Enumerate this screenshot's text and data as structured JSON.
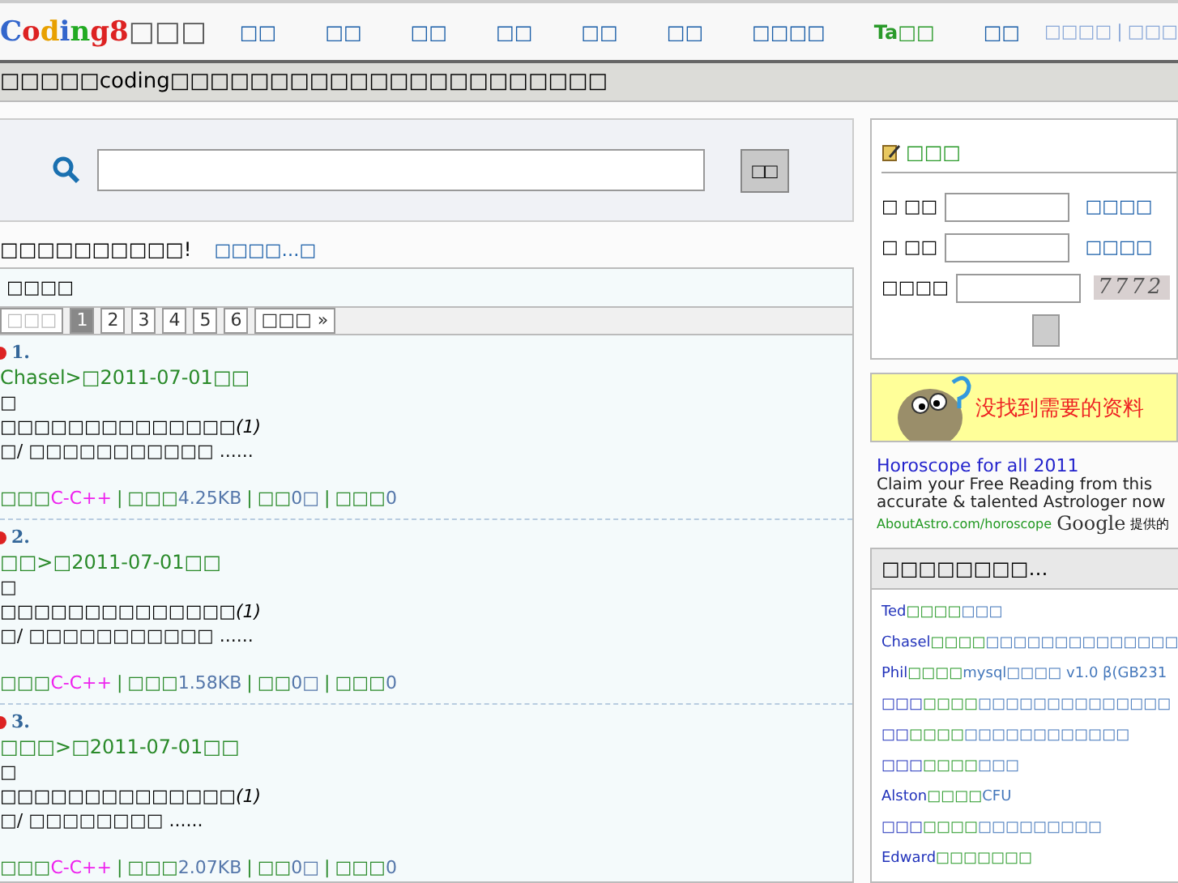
{
  "header": {
    "logo_letters": [
      {
        "ch": "C",
        "color": "#3366cc"
      },
      {
        "ch": "o",
        "color": "#dd2222"
      },
      {
        "ch": "d",
        "color": "#e8a000"
      },
      {
        "ch": "i",
        "color": "#3366cc"
      },
      {
        "ch": "n",
        "color": "#22aa22"
      },
      {
        "ch": "g",
        "color": "#dd2222"
      },
      {
        "ch": "8",
        "color": "#dd2222"
      }
    ],
    "logo_suffix": "□□□",
    "nav": [
      {
        "label": "□□",
        "kind": "normal"
      },
      {
        "label": "□□",
        "kind": "normal"
      },
      {
        "label": "□□",
        "kind": "normal"
      },
      {
        "label": "□□",
        "kind": "normal"
      },
      {
        "label": "□□",
        "kind": "normal"
      },
      {
        "label": "□□",
        "kind": "normal"
      },
      {
        "label": "□□□□",
        "kind": "normal"
      },
      {
        "label": "Ta□□",
        "kind": "highlight"
      },
      {
        "label": "□□",
        "kind": "normal"
      }
    ],
    "account_links": [
      "□□□□",
      "□□□"
    ],
    "account_separator": "|"
  },
  "tagline": "□□□□□coding□□□□□□□□□□□□□□□□□□□□□□",
  "search": {
    "button": "□□"
  },
  "notice": {
    "text": "□□□□□□□□□□!",
    "link": "□□□□…□"
  },
  "results": {
    "title": "□□□□",
    "meta_separator": "|",
    "pager": [
      {
        "label": "□□□",
        "kind": "prev",
        "selected": false
      },
      {
        "label": "1",
        "kind": "page",
        "selected": true
      },
      {
        "label": "2",
        "kind": "page",
        "selected": false
      },
      {
        "label": "3",
        "kind": "page",
        "selected": false
      },
      {
        "label": "4",
        "kind": "page",
        "selected": false
      },
      {
        "label": "5",
        "kind": "page",
        "selected": false
      },
      {
        "label": "6",
        "kind": "page",
        "selected": false
      },
      {
        "label": "□□□ »",
        "kind": "next",
        "selected": false
      }
    ],
    "items": [
      {
        "number": "1.",
        "byline": "Chasel>□2011-07-01□□",
        "line1": "□",
        "title": "□□□□□□□□□□□□□□",
        "note": "(1)",
        "excerpt": "□/ □□□□□□□□□□□  ......",
        "meta": [
          {
            "label": "□□□",
            "value": "C-C++",
            "kind": "category"
          },
          {
            "label": "□□□",
            "value": "4.25KB",
            "kind": "plain"
          },
          {
            "label": "□□",
            "value": "0□",
            "kind": "plain"
          },
          {
            "label": "□□□",
            "value": "0",
            "kind": "plain"
          }
        ]
      },
      {
        "number": "2.",
        "byline": "□□>□2011-07-01□□",
        "line1": "□",
        "title": "□□□□□□□□□□□□□□",
        "note": "(1)",
        "excerpt": "□/ □□□□□□□□□□□  ......",
        "meta": [
          {
            "label": "□□□",
            "value": "C-C++",
            "kind": "category"
          },
          {
            "label": "□□□",
            "value": "1.58KB",
            "kind": "plain"
          },
          {
            "label": "□□",
            "value": "0□",
            "kind": "plain"
          },
          {
            "label": "□□□",
            "value": "0",
            "kind": "plain"
          }
        ]
      },
      {
        "number": "3.",
        "byline": "□□□>□2011-07-01□□",
        "line1": "□",
        "title": "□□□□□□□□□□□□□□",
        "note": "(1)",
        "excerpt": "□/ □□□□□□□□  ......",
        "meta": [
          {
            "label": "□□□",
            "value": "C-C++",
            "kind": "category"
          },
          {
            "label": "□□□",
            "value": "2.07KB",
            "kind": "plain"
          },
          {
            "label": "□□",
            "value": "0□",
            "kind": "plain"
          },
          {
            "label": "□□□",
            "value": "0",
            "kind": "plain"
          }
        ]
      }
    ]
  },
  "login": {
    "title": "□□□",
    "fields": [
      {
        "label": "□  □□",
        "link": "□□□□",
        "kind": "text"
      },
      {
        "label": "□  □□",
        "link": "□□□□",
        "kind": "password"
      },
      {
        "label": "□□□□",
        "captcha": "7772",
        "kind": "captcha"
      }
    ]
  },
  "banner": {
    "text": "没找到需要的资料"
  },
  "ad": {
    "title": "Horoscope for all 2011",
    "body": "Claim your Free Reading from this accurate & talented Astrologer now",
    "url": "AboutAstro.com/horoscope",
    "brand": "Google",
    "brand_suffix": "提供的"
  },
  "recent": {
    "title": "□□□□□□□□…",
    "items": [
      {
        "user": "Ted",
        "action": "□□□□",
        "subject": "□□□"
      },
      {
        "user": "Chasel",
        "action": "□□□□",
        "subject": "□□□□□□□□□□□□□□"
      },
      {
        "user": "Phil",
        "action": "□□□□",
        "subject": "mysql□□□□ v1.0 β(GB231"
      },
      {
        "user": "□□□",
        "action": "□□□□",
        "subject": "□□□□□□□□□□□□□□"
      },
      {
        "user": "□□",
        "action": "□□□□",
        "subject": "□□□□□□□□□□□□"
      },
      {
        "user": "□□□",
        "action": "□□□□",
        "subject": "□□□"
      },
      {
        "user": "Alston",
        "action": "□□□□",
        "subject": "CFU"
      },
      {
        "user": "□□□",
        "action": "□□□□",
        "subject": "□□□□□□□□□"
      },
      {
        "user": "Edward",
        "action": "□□□□□□□"
      }
    ]
  }
}
